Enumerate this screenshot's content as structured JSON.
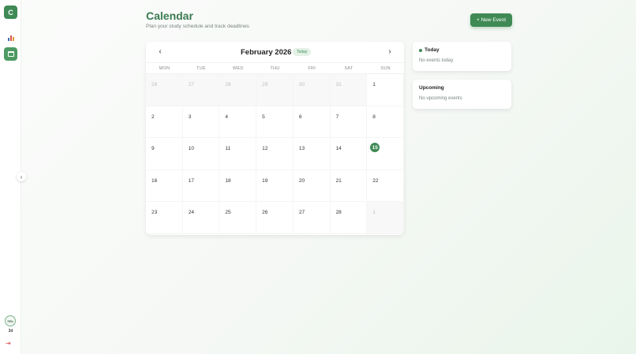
{
  "sidebar": {
    "logo_letter": "C",
    "avatar_text": "75%",
    "user_label": "3d"
  },
  "header": {
    "title": "Calendar",
    "subtitle": "Plan your study schedule and track deadlines",
    "new_event_label": "+ New Event"
  },
  "calendar": {
    "month_label": "February 2026",
    "today_label": "Today",
    "weekdays": [
      "MON",
      "TUE",
      "WED",
      "THU",
      "FRI",
      "SAT",
      "SUN"
    ],
    "days": [
      {
        "n": "26",
        "other": true
      },
      {
        "n": "27",
        "other": true
      },
      {
        "n": "28",
        "other": true
      },
      {
        "n": "29",
        "other": true
      },
      {
        "n": "30",
        "other": true
      },
      {
        "n": "31",
        "other": true
      },
      {
        "n": "1"
      },
      {
        "n": "2"
      },
      {
        "n": "3"
      },
      {
        "n": "4"
      },
      {
        "n": "5"
      },
      {
        "n": "6"
      },
      {
        "n": "7"
      },
      {
        "n": "8"
      },
      {
        "n": "9"
      },
      {
        "n": "10"
      },
      {
        "n": "11"
      },
      {
        "n": "12"
      },
      {
        "n": "13"
      },
      {
        "n": "14"
      },
      {
        "n": "15",
        "today": true
      },
      {
        "n": "16"
      },
      {
        "n": "17"
      },
      {
        "n": "18"
      },
      {
        "n": "19"
      },
      {
        "n": "20"
      },
      {
        "n": "21"
      },
      {
        "n": "22"
      },
      {
        "n": "23"
      },
      {
        "n": "24"
      },
      {
        "n": "25"
      },
      {
        "n": "26"
      },
      {
        "n": "27"
      },
      {
        "n": "28"
      },
      {
        "n": "1",
        "other": true
      }
    ]
  },
  "today_card": {
    "title": "Today",
    "empty": "No events today"
  },
  "upcoming_card": {
    "title": "Upcoming",
    "empty": "No upcoming events"
  },
  "colors": {
    "accent": "#3f8a55",
    "accent_light": "#e3f1e6"
  },
  "icons": {
    "analytics": "bar-chart-icon",
    "calendar": "calendar-icon",
    "collapse": "chevron-right-icon",
    "logout": "logout-icon"
  }
}
